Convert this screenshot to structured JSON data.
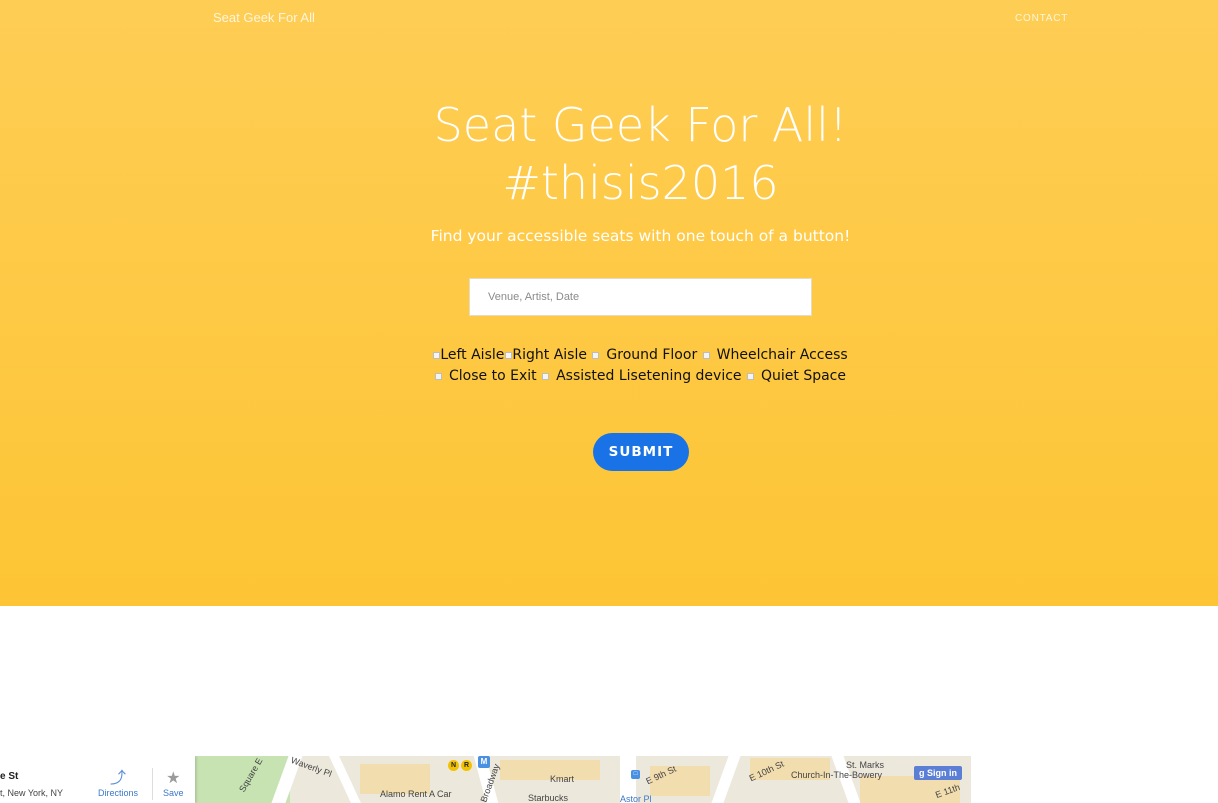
{
  "nav": {
    "brand": "Seat Geek For All",
    "contact": "CONTACT"
  },
  "hero": {
    "title_line1": "Seat Geek For All!",
    "title_line2": "#thisis2016",
    "tagline": "Find your accessible seats with one touch of a button!",
    "search_placeholder": "Venue, Artist, Date",
    "options_row1": [
      "Left Aisle",
      "Right Aisle",
      "Ground Floor",
      "Wheelchair Access"
    ],
    "options_row2": [
      "Close to Exit",
      "Assisted Lisetening device",
      "Quiet Space"
    ],
    "submit_label": "SUBMIT"
  },
  "map": {
    "place_title": "e St",
    "place_address": "t, New York, NY",
    "directions_label": "Directions",
    "save_label": "Save",
    "sign_in_label": "Sign in",
    "labels": [
      "Waverly Pl",
      "Square E",
      "Alamo Rent A Car",
      "Starbucks",
      "Broadway",
      "Kmart",
      "E 9th St",
      "Astor Pl",
      "E 10th St",
      "St. Marks",
      "Church-In-The-Bowery",
      "E 11th"
    ],
    "metro_lines": [
      "N",
      "R",
      "M"
    ]
  },
  "colors": {
    "hero_top": "#fecd54",
    "hero_bottom": "#fdc535",
    "submit": "#1973e6"
  }
}
